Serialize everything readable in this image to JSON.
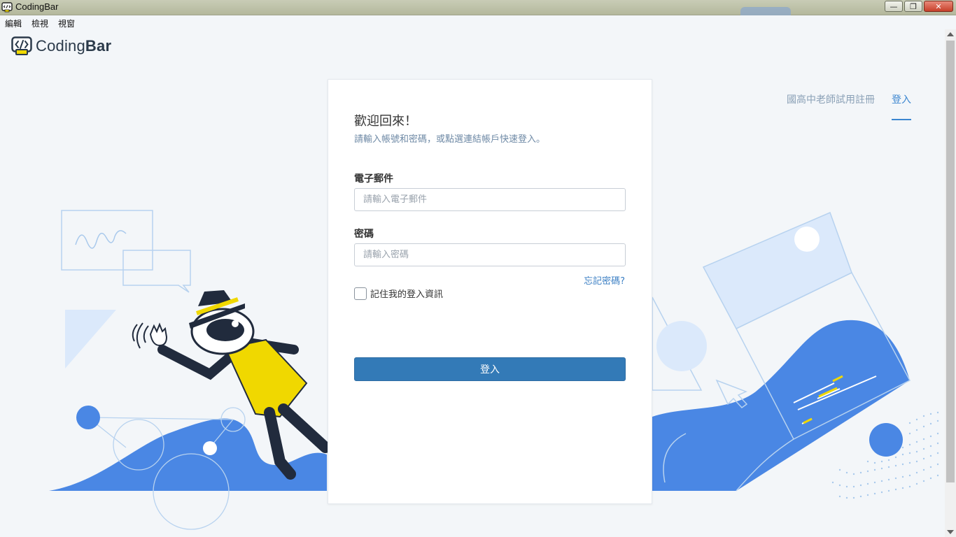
{
  "window": {
    "title": "CodingBar",
    "min_symbol": "—",
    "max_symbol": "❐",
    "close_symbol": "✕"
  },
  "menubar": {
    "items": [
      {
        "label": "編輯"
      },
      {
        "label": "檢視"
      },
      {
        "label": "視窗"
      }
    ]
  },
  "logo": {
    "text_light": "Coding",
    "text_bold": "Bar",
    "icon": "code-brackets-icon"
  },
  "nav": {
    "register_label": "國高中老師試用註冊",
    "login_label": "登入"
  },
  "login": {
    "welcome": "歡迎回來！",
    "subtitle": "請輸入帳號和密碼，或點選連結帳戶快速登入。",
    "email_label": "電子郵件",
    "email_placeholder": "請輸入電子郵件",
    "email_value": "",
    "password_label": "密碼",
    "password_placeholder": "請輸入密碼",
    "password_value": "",
    "forgot_label": "忘記密碼?",
    "remember_label": "記住我的登入資訊",
    "remember_checked": false,
    "submit_label": "登入"
  },
  "colors": {
    "accent": "#3b86d0",
    "button": "#337ab7",
    "illustration_blue": "#4a87e4",
    "illustration_yellow": "#f0d800",
    "illustration_dark": "#212b3d"
  }
}
